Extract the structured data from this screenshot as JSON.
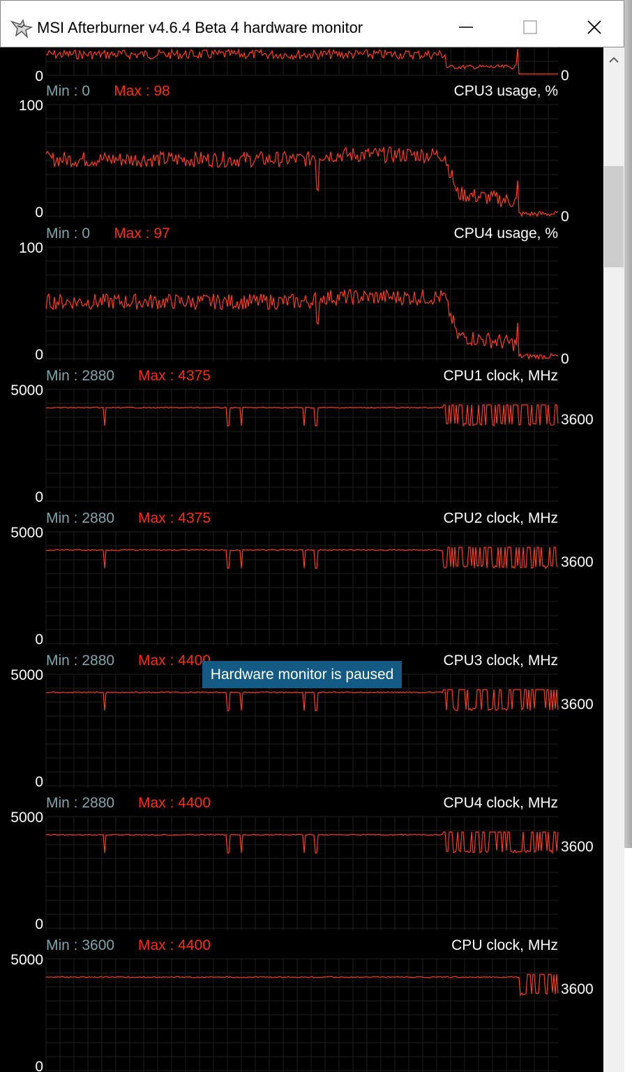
{
  "window": {
    "title": "MSI Afterburner v4.6.4 Beta 4 hardware monitor",
    "icon": "msi-afterburner-icon"
  },
  "colors": {
    "background": "#000000",
    "grid": "#1f1f1f",
    "graph_line": "#ff3a1e",
    "min_text": "#7fa5ad",
    "max_text": "#ff2a10",
    "label_text": "#ffffff",
    "paused_bg": "#135a84"
  },
  "top_partial_graph": {
    "y_min_label": "0",
    "current_value": "0"
  },
  "graphs": [
    {
      "name": "CPU3 usage, %",
      "min_label": "Min : 0",
      "max_label": "Max : 98",
      "y_max_label": "100",
      "y_min_label": "0",
      "current_value": "0",
      "range": [
        0,
        100
      ],
      "shape": "usage"
    },
    {
      "name": "CPU4 usage, %",
      "min_label": "Min : 0",
      "max_label": "Max : 97",
      "y_max_label": "100",
      "y_min_label": "0",
      "current_value": "0",
      "range": [
        0,
        100
      ],
      "shape": "usage"
    },
    {
      "name": "CPU1 clock, MHz",
      "min_label": "Min : 2880",
      "max_label": "Max : 4375",
      "y_max_label": "5000",
      "y_min_label": "0",
      "current_value": "3600",
      "range": [
        0,
        5000
      ],
      "shape": "clock"
    },
    {
      "name": "CPU2 clock, MHz",
      "min_label": "Min : 2880",
      "max_label": "Max : 4375",
      "y_max_label": "5000",
      "y_min_label": "0",
      "current_value": "3600",
      "range": [
        0,
        5000
      ],
      "shape": "clock"
    },
    {
      "name": "CPU3 clock, MHz",
      "min_label": "Min : 2880",
      "max_label": "Max : 4400",
      "y_max_label": "5000",
      "y_min_label": "0",
      "current_value": "3600",
      "range": [
        0,
        5000
      ],
      "shape": "clock"
    },
    {
      "name": "CPU4 clock, MHz",
      "min_label": "Min : 2880",
      "max_label": "Max : 4400",
      "y_max_label": "5000",
      "y_min_label": "0",
      "current_value": "3600",
      "range": [
        0,
        5000
      ],
      "shape": "clock"
    },
    {
      "name": "CPU clock, MHz",
      "min_label": "Min : 3600",
      "max_label": "Max : 4400",
      "y_max_label": "5000",
      "y_min_label": "0",
      "current_value": "3600",
      "range": [
        0,
        5000
      ],
      "shape": "clock-late"
    }
  ],
  "status": {
    "paused_text": "Hardware monitor is paused"
  }
}
